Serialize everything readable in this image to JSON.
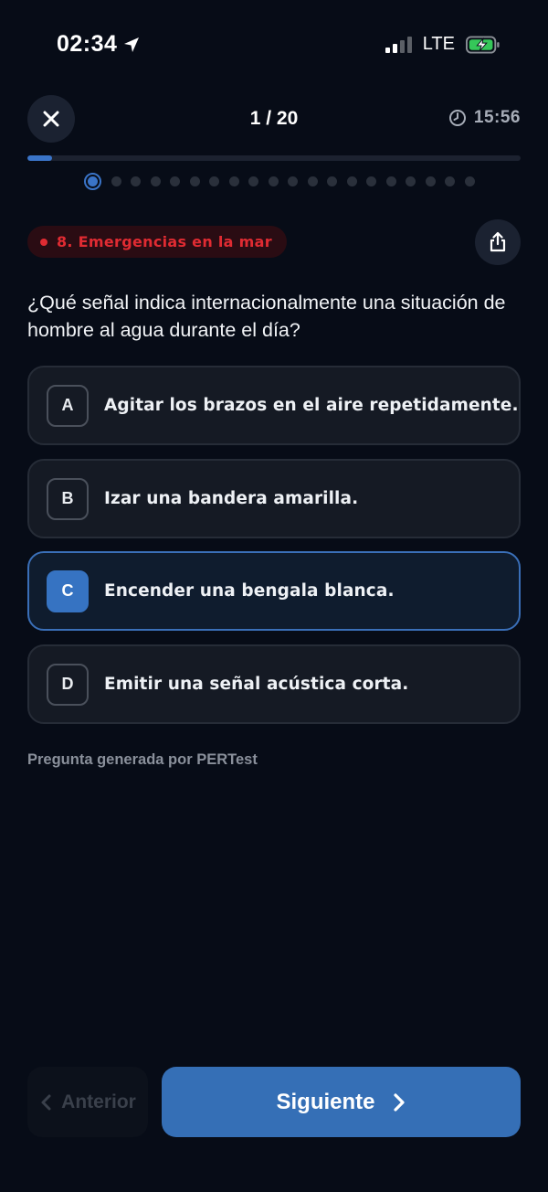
{
  "status_bar": {
    "time": "02:34",
    "network": "LTE"
  },
  "header": {
    "counter": "1 / 20",
    "timer": "15:56",
    "progress_fraction": 0.05,
    "total_dots": 20,
    "current_dot": 1
  },
  "category": {
    "label": "8. Emergencias en la mar",
    "color": "#e02b32"
  },
  "question": {
    "text": "¿Qué señal indica internacionalmente una situación de hombre al agua durante el día?"
  },
  "options": [
    {
      "letter": "A",
      "text": "Agitar los brazos en el aire repetidamente.",
      "selected": false
    },
    {
      "letter": "B",
      "text": "Izar una bandera amarilla.",
      "selected": false
    },
    {
      "letter": "C",
      "text": "Encender una bengala blanca.",
      "selected": true
    },
    {
      "letter": "D",
      "text": "Emitir una señal acústica corta.",
      "selected": false
    }
  ],
  "credit": "Pregunta generada por PERTest",
  "footer": {
    "prev_label": "Anterior",
    "next_label": "Siguiente"
  },
  "colors": {
    "accent": "#3a74c8",
    "background": "#070c17",
    "card": "#151a24"
  },
  "icons": {
    "location": "location-arrow-icon",
    "close": "close-icon",
    "clock": "clock-icon",
    "share": "share-icon",
    "prev": "chevron-left-icon",
    "next": "chevron-right-icon"
  }
}
